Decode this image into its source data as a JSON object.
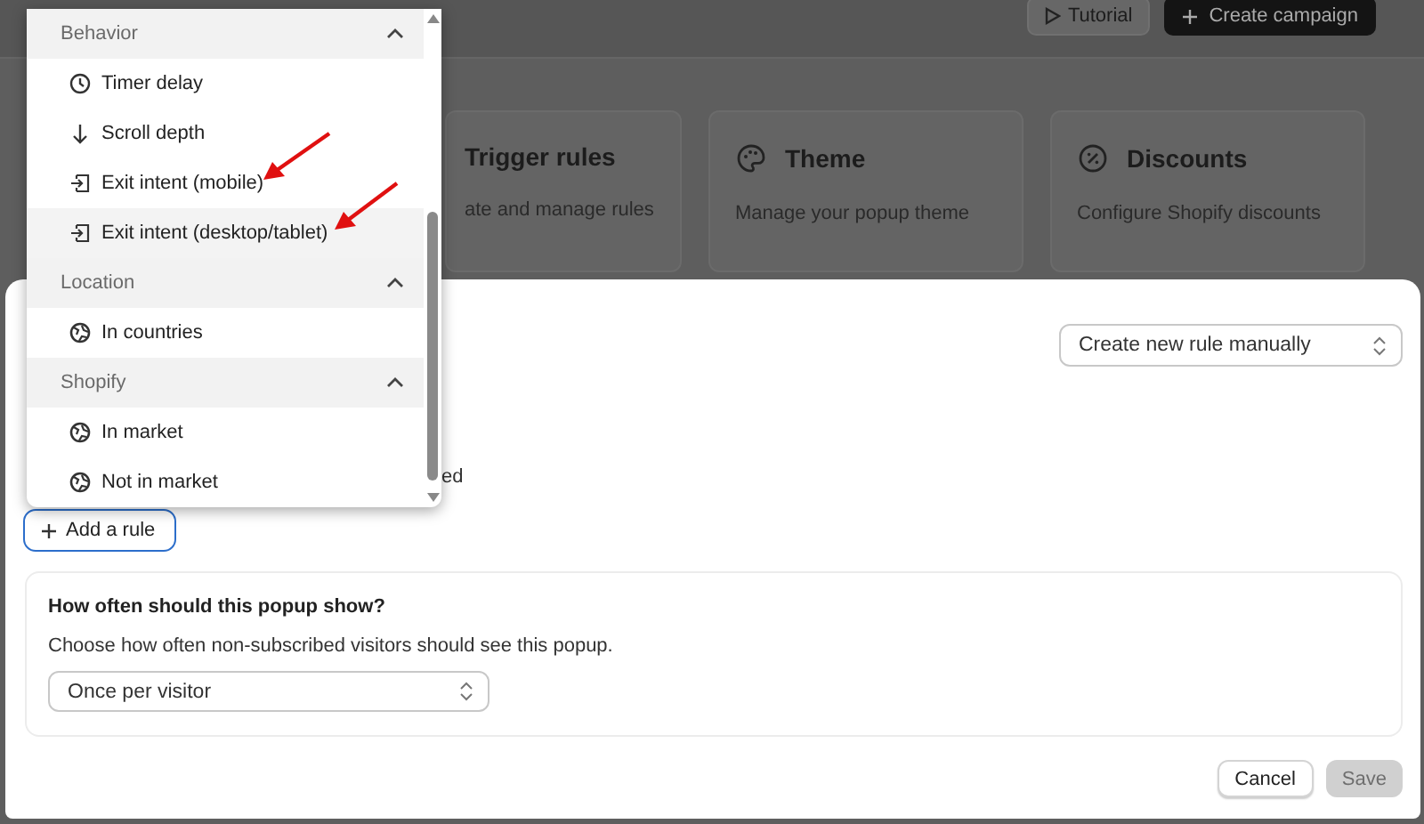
{
  "page": {
    "tutorial_button": "Tutorial",
    "create_button": "Create campaign",
    "cards": [
      {
        "kind": "trigger",
        "title": "Trigger rules",
        "description": "ate and manage rules"
      },
      {
        "kind": "theme",
        "title": "Theme",
        "description": "Manage your popup theme"
      },
      {
        "kind": "discount",
        "title": "Discounts",
        "description": "Configure Shopify discounts"
      }
    ]
  },
  "modal": {
    "rule_source_select": "Create new rule manually",
    "partial_text": "ed",
    "add_rule_button": "Add a rule",
    "frequency": {
      "title": "How often should this popup show?",
      "description": "Choose how often non-subscribed visitors should see this popup.",
      "select": "Once per visitor"
    },
    "buttons": [
      {
        "label": "Cancel",
        "kind": "secondary",
        "disabled": false
      },
      {
        "label": "Save",
        "kind": "primary",
        "disabled": true
      }
    ]
  },
  "dropdown": {
    "groups": [
      {
        "label": "Behavior",
        "expanded": true,
        "items": [
          {
            "label": "Timer delay",
            "kind": "clock",
            "hovered": false
          },
          {
            "label": "Scroll depth",
            "kind": "scroll",
            "hovered": false
          },
          {
            "label": "Exit intent (mobile)",
            "kind": "exit",
            "hovered": false
          },
          {
            "label": "Exit intent (desktop/tablet)",
            "kind": "exit",
            "hovered": true
          }
        ]
      },
      {
        "label": "Location",
        "expanded": true,
        "items": [
          {
            "label": "In countries",
            "kind": "geo",
            "hovered": false
          }
        ]
      },
      {
        "label": "Shopify",
        "expanded": true,
        "items": [
          {
            "label": "In market",
            "kind": "geo",
            "hovered": false
          },
          {
            "label": "Not in market",
            "kind": "geo",
            "hovered": false
          }
        ]
      }
    ]
  }
}
